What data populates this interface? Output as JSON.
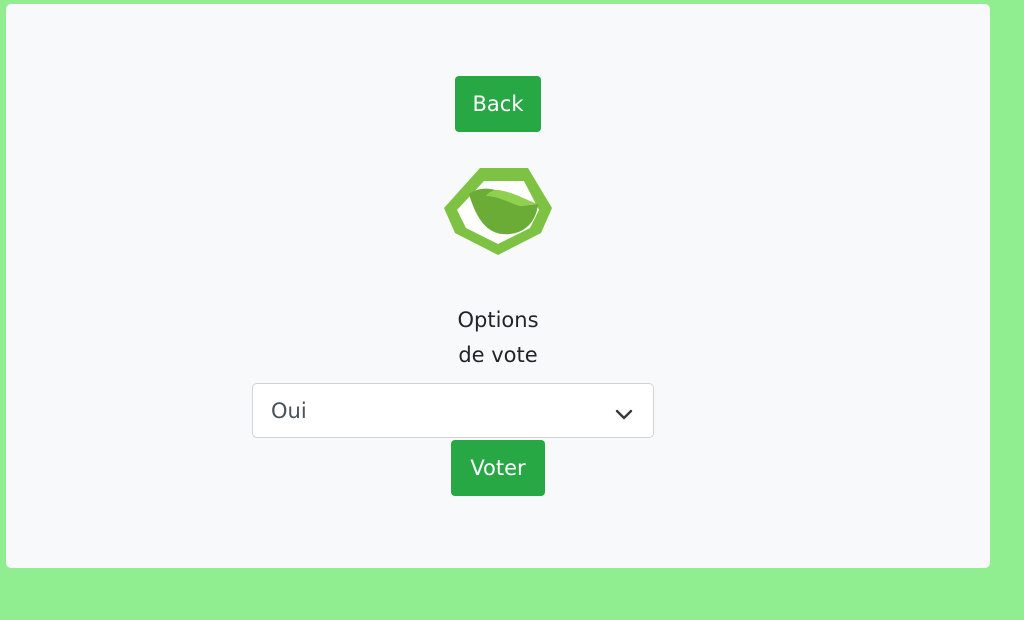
{
  "colors": {
    "page_background": "#90ee90",
    "card_background": "#f8f9fa",
    "button": "#28a745",
    "logo": "#7dc242"
  },
  "nav": {
    "back_label": "Back"
  },
  "logo": {
    "icon": "leaf-logo-icon"
  },
  "form": {
    "label_line1": "Options",
    "label_line2": "de vote",
    "select_value": "Oui",
    "submit_label": "Voter"
  }
}
